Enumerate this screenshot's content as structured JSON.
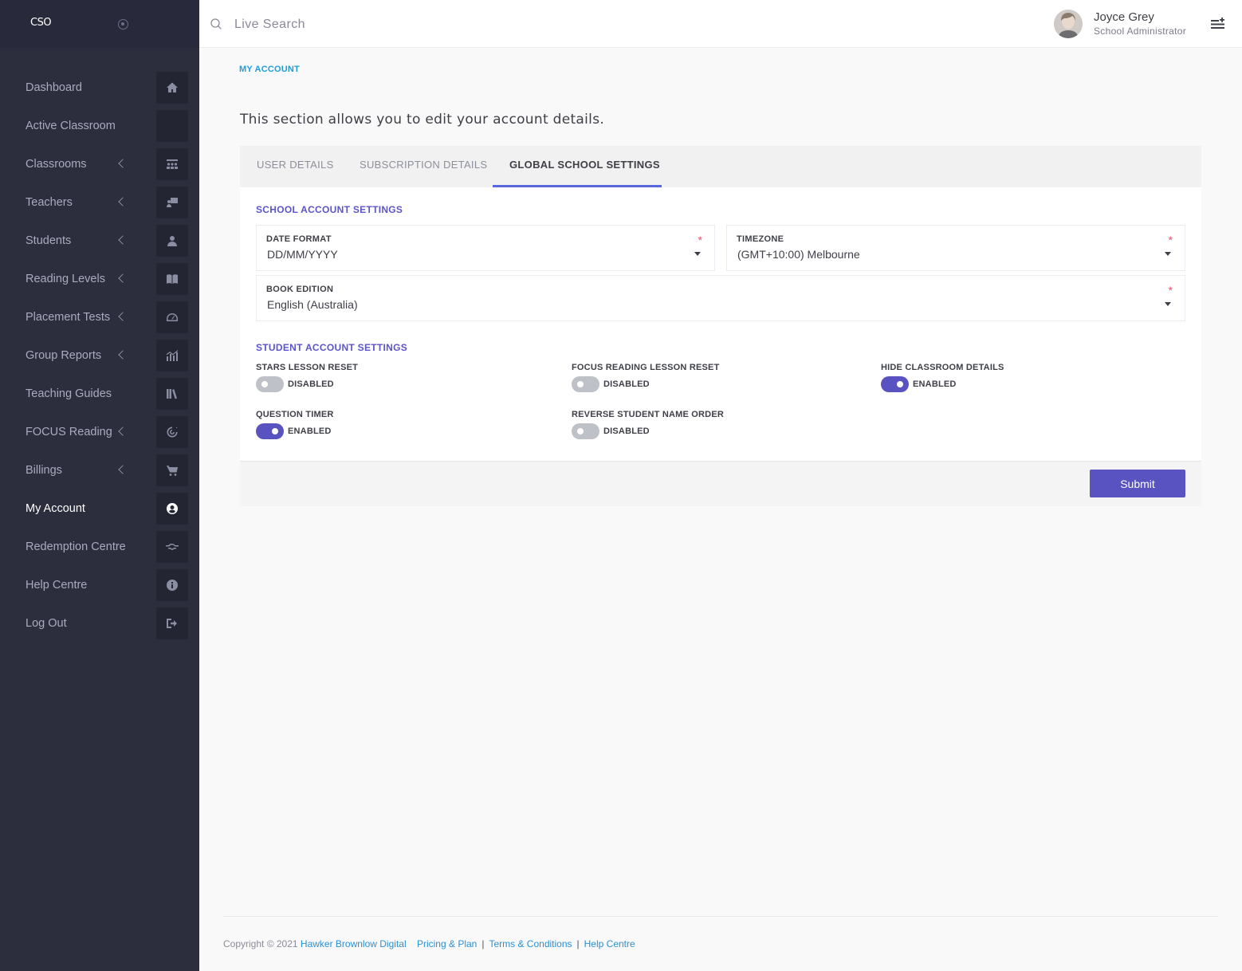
{
  "brand": {
    "logo_text": "CSO"
  },
  "sidebar": {
    "items": [
      {
        "label": "Dashboard",
        "icon": "home-icon",
        "has_submenu": false,
        "active": false
      },
      {
        "label": "Active Classroom",
        "icon": "",
        "has_submenu": false,
        "active": false
      },
      {
        "label": "Classrooms",
        "icon": "classroom-icon",
        "has_submenu": true,
        "active": false
      },
      {
        "label": "Teachers",
        "icon": "teacher-icon",
        "has_submenu": true,
        "active": false
      },
      {
        "label": "Students",
        "icon": "student-icon",
        "has_submenu": true,
        "active": false
      },
      {
        "label": "Reading Levels",
        "icon": "book-icon",
        "has_submenu": true,
        "active": false
      },
      {
        "label": "Placement Tests",
        "icon": "gauge-icon",
        "has_submenu": true,
        "active": false
      },
      {
        "label": "Group Reports",
        "icon": "chart-icon",
        "has_submenu": true,
        "active": false
      },
      {
        "label": "Teaching Guides",
        "icon": "books-icon",
        "has_submenu": false,
        "active": false
      },
      {
        "label": "FOCUS Reading",
        "icon": "target-icon",
        "has_submenu": true,
        "active": false
      },
      {
        "label": "Billings",
        "icon": "cart-icon",
        "has_submenu": true,
        "active": false
      },
      {
        "label": "My Account",
        "icon": "user-circle-icon",
        "has_submenu": false,
        "active": true
      },
      {
        "label": "Redemption Centre",
        "icon": "handshake-icon",
        "has_submenu": false,
        "active": false
      },
      {
        "label": "Help Centre",
        "icon": "info-icon",
        "has_submenu": false,
        "active": false
      },
      {
        "label": "Log Out",
        "icon": "logout-icon",
        "has_submenu": false,
        "active": false
      }
    ]
  },
  "header": {
    "search_placeholder": "Live Search",
    "user_name": "Joyce Grey",
    "user_role": "School Administrator"
  },
  "main": {
    "breadcrumb": "MY ACCOUNT",
    "intro": "This section allows you to edit your account details.",
    "tabs": [
      {
        "label": "USER DETAILS",
        "active": false
      },
      {
        "label": "SUBSCRIPTION DETAILS",
        "active": false
      },
      {
        "label": "GLOBAL SCHOOL SETTINGS",
        "active": true
      }
    ],
    "school_settings": {
      "title": "SCHOOL ACCOUNT SETTINGS",
      "date_format": {
        "label": "DATE FORMAT",
        "value": "DD/MM/YYYY",
        "required": "*"
      },
      "timezone": {
        "label": "TIMEZONE",
        "value": "(GMT+10:00) Melbourne",
        "required": "*"
      },
      "book_edition": {
        "label": "BOOK EDITION",
        "value": "English (Australia)",
        "required": "*"
      }
    },
    "student_settings": {
      "title": "STUDENT ACCOUNT SETTINGS",
      "toggles": [
        {
          "label": "STARS LESSON RESET",
          "state": "DISABLED",
          "on": false
        },
        {
          "label": "FOCUS READING LESSON RESET",
          "state": "DISABLED",
          "on": false
        },
        {
          "label": "HIDE CLASSROOM DETAILS",
          "state": "ENABLED",
          "on": true
        },
        {
          "label": "QUESTION TIMER",
          "state": "ENABLED",
          "on": true
        },
        {
          "label": "REVERSE STUDENT NAME ORDER",
          "state": "DISABLED",
          "on": false
        }
      ]
    },
    "submit_label": "Submit"
  },
  "footer": {
    "copyright": "Copyright © 2021",
    "company": "Hawker Brownlow Digital",
    "links": [
      "Pricing & Plan",
      "Terms & Conditions",
      "Help Centre"
    ]
  },
  "colors": {
    "sidebar_bg": "#2c2e3e",
    "accent": "#5953c1",
    "tab_underline": "#5867dd",
    "link": "#2d8fd1",
    "required": "#f4516c"
  }
}
